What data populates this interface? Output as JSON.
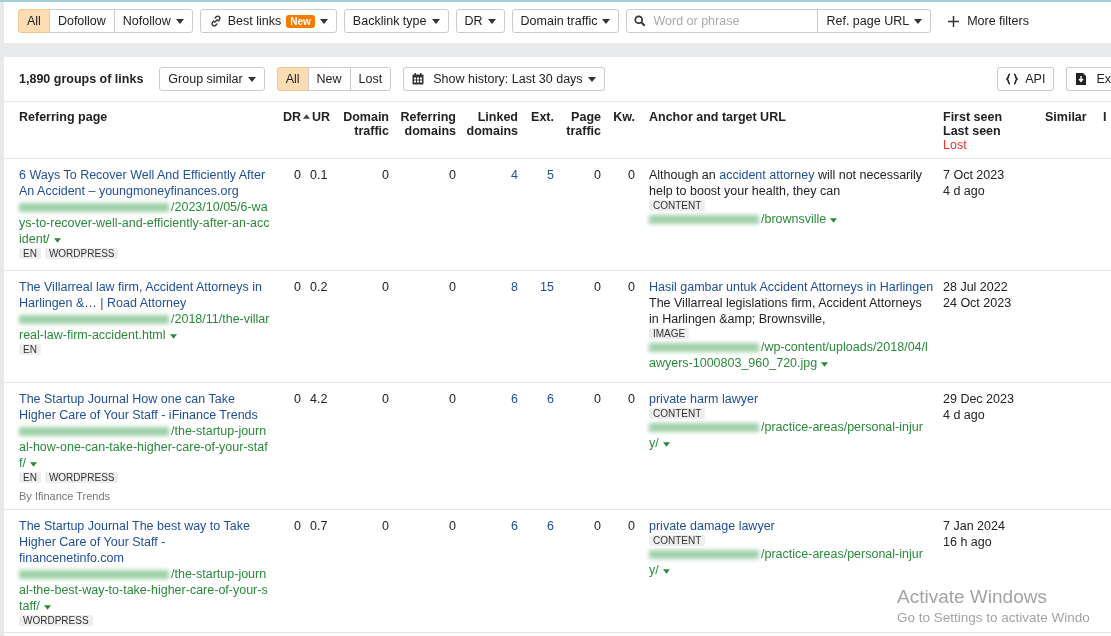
{
  "filters": {
    "link_types": [
      {
        "label": "All",
        "selected": true
      },
      {
        "label": "Dofollow",
        "selected": false
      },
      {
        "label": "Nofollow",
        "selected": false,
        "dropdown": true
      }
    ],
    "dropdowns": [
      {
        "label": "Best links",
        "badge": "New",
        "kind": "best"
      },
      {
        "label": "Backlink type",
        "kind": "plain"
      },
      {
        "label": "DR",
        "kind": "plain"
      },
      {
        "label": "Domain traffic",
        "kind": "plain"
      }
    ],
    "search": {
      "placeholder": "Word or phrase",
      "scope": "Ref. page URL"
    },
    "more": "More filters"
  },
  "summary": {
    "count": "1,890 groups of links",
    "group": "Group similar",
    "history_tabs": [
      {
        "label": "All",
        "selected": true
      },
      {
        "label": "New",
        "selected": false
      },
      {
        "label": "Lost",
        "selected": false
      }
    ],
    "history": "Show history: Last 30 days",
    "api": "API",
    "export": "Ex"
  },
  "table": {
    "columns": [
      {
        "label": "Referring page"
      },
      {
        "label": "DR",
        "sorted": true
      },
      {
        "label": "UR"
      },
      {
        "label": "Domain traffic"
      },
      {
        "label": "Referring domains"
      },
      {
        "label": "Linked domains"
      },
      {
        "label": "Ext."
      },
      {
        "label": "Page traffic"
      },
      {
        "label": "Kw."
      },
      {
        "label": "Anchor and target URL"
      },
      {
        "label": "First seen",
        "sub": "Last seen",
        "status": "Lost"
      },
      {
        "label": "Similar"
      },
      {
        "label": "I"
      }
    ],
    "rows": [
      {
        "title": "6 Ways To Recover Well And Efficiently After An Accident – youngmoneyfinances.org",
        "url": "/2023/10/05/6-ways-to-recover-well-and-efficiently-after-an-accident/",
        "tags": [
          "EN",
          "WORDPRESS"
        ],
        "dr": "0",
        "ur": "0.1",
        "domain_traffic": "0",
        "referring_domains": "0",
        "linked_domains": "4",
        "ext": "5",
        "page_traffic": "0",
        "kw": "0",
        "anchor": [
          {
            "text": "Although an ",
            "link": false
          },
          {
            "text": "accident attorney",
            "link": true
          },
          {
            "text": " will not necessarily help to boost your health, they can",
            "link": false
          }
        ],
        "anchor_type": "CONTENT",
        "target": "/brownsville",
        "first_seen": "7 Oct 2023",
        "last_seen": "4 d ago"
      },
      {
        "title": "The Villarreal law firm, Accident Attorneys in Harlingen &… | Road Attorney",
        "url": "/2018/11/the-villarreal-law-firm-accident.html",
        "tags": [
          "EN"
        ],
        "dr": "0",
        "ur": "0.2",
        "domain_traffic": "0",
        "referring_domains": "0",
        "linked_domains": "8",
        "ext": "15",
        "page_traffic": "0",
        "kw": "0",
        "anchor": [
          {
            "text": "Hasil gambar untuk Accident Attorneys in Harlingen",
            "link": true
          },
          {
            "text": " The Villarreal legislations firm, Accident Attorneys in Harlingen &amp; Brownsville,",
            "link": false
          }
        ],
        "anchor_type": "IMAGE",
        "target": "/wp-content/uploads/2018/04/lawyers-1000803_960_720.jpg",
        "first_seen": "28 Jul 2022",
        "last_seen": "24 Oct 2023"
      },
      {
        "title": "The Startup Journal How one can Take Higher Care of Your Staff - iFinance Trends",
        "url": "/the-startup-journal-how-one-can-take-higher-care-of-your-staff/",
        "tags": [
          "EN",
          "WORDPRESS"
        ],
        "author": "By Ifinance Trends",
        "dr": "0",
        "ur": "4.2",
        "domain_traffic": "0",
        "referring_domains": "0",
        "linked_domains": "6",
        "ext": "6",
        "page_traffic": "0",
        "kw": "0",
        "anchor": [
          {
            "text": "private harm lawyer",
            "link": true
          }
        ],
        "anchor_type": "CONTENT",
        "target": "/practice-areas/personal-injury/",
        "first_seen": "29 Dec 2023",
        "last_seen": "4 d ago"
      },
      {
        "title": "The Startup Journal The best way to Take Higher Care of Your Staff - financenetinfo.com",
        "url": "/the-startup-journal-the-best-way-to-take-higher-care-of-your-staff/",
        "tags": [
          "WORDPRESS"
        ],
        "dr": "0",
        "ur": "0.7",
        "domain_traffic": "0",
        "referring_domains": "0",
        "linked_domains": "6",
        "ext": "6",
        "page_traffic": "0",
        "kw": "0",
        "anchor": [
          {
            "text": "private damage lawyer",
            "link": true
          }
        ],
        "anchor_type": "CONTENT",
        "target": "/practice-areas/personal-injury/",
        "first_seen": "7 Jan 2024",
        "last_seen": "16 h ago"
      }
    ]
  },
  "os_watermark": {
    "title": "Activate Windows",
    "subtitle": "Go to Settings to activate Windo"
  }
}
